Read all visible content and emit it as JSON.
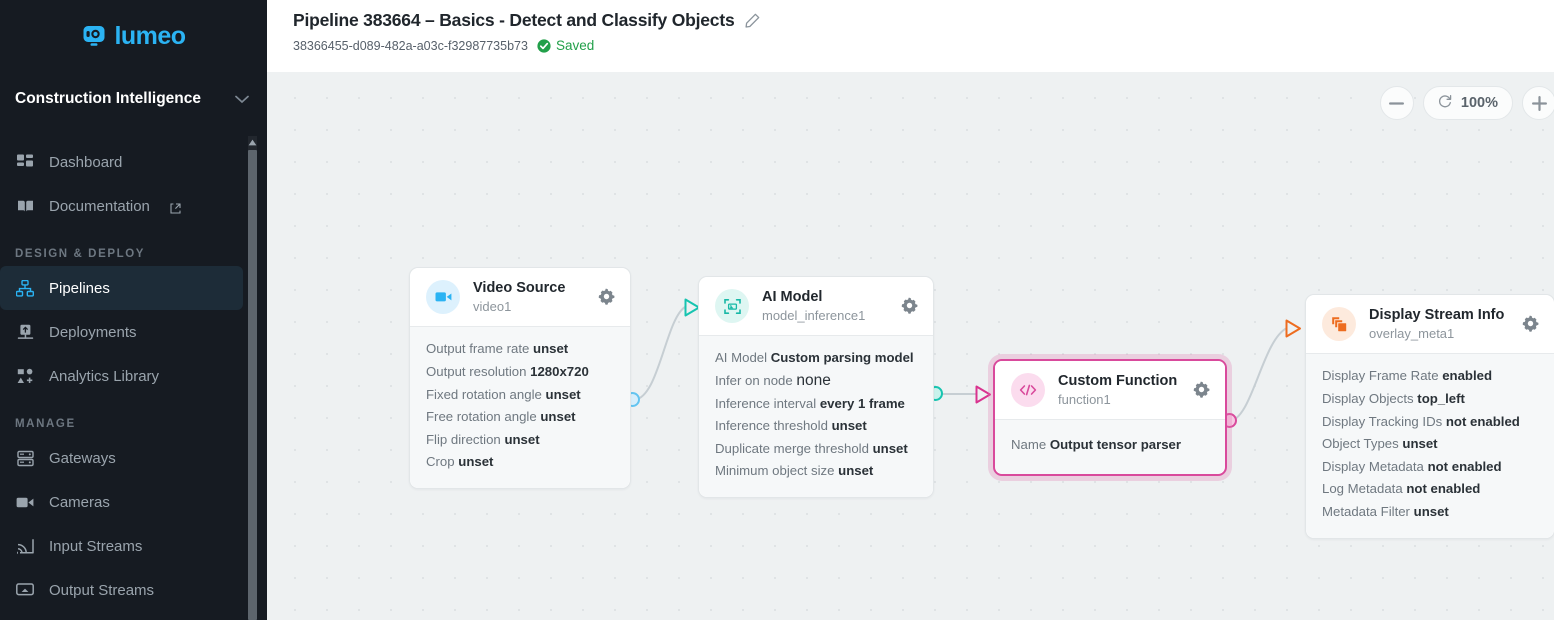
{
  "brand": {
    "name": "lumeo",
    "icon": "camera-logo-icon",
    "color": "#2bb3f3"
  },
  "sidebar": {
    "org": {
      "name": "Construction Intelligence",
      "chevron": "chevron-down-icon"
    },
    "items": [
      {
        "label": "Dashboard",
        "icon": "dashboard-grid-icon",
        "active": false,
        "external": false
      },
      {
        "label": "Documentation",
        "icon": "book-icon",
        "active": false,
        "external": true
      }
    ],
    "sections": [
      {
        "label": "DESIGN & DEPLOY",
        "items": [
          {
            "label": "Pipelines",
            "icon": "pipeline-nodes-icon",
            "active": true,
            "external": false
          },
          {
            "label": "Deployments",
            "icon": "deployment-upload-icon",
            "active": false,
            "external": false
          },
          {
            "label": "Analytics Library",
            "icon": "analytics-shapes-icon",
            "active": false,
            "external": false
          }
        ]
      },
      {
        "label": "MANAGE",
        "items": [
          {
            "label": "Gateways",
            "icon": "server-rack-icon",
            "active": false,
            "external": false
          },
          {
            "label": "Cameras",
            "icon": "video-camera-icon",
            "active": false,
            "external": false
          },
          {
            "label": "Input Streams",
            "icon": "stream-cast-icon",
            "active": false,
            "external": false
          },
          {
            "label": "Output Streams",
            "icon": "monitor-output-icon",
            "active": false,
            "external": false
          }
        ]
      }
    ]
  },
  "header": {
    "title": "Pipeline 383664 – Basics - Detect and Classify Objects",
    "edit_icon": "pencil-icon",
    "pipeline_id": "38366455-d089-482a-a03c-f32987735b73",
    "status_icon": "check-circle-icon",
    "status_text": "Saved",
    "status_color": "#22a04a"
  },
  "canvas": {
    "zoom": {
      "minus_label": "−",
      "plus_label": "+",
      "reset_icon": "refresh-icon",
      "level": "100%"
    },
    "nodes": [
      {
        "id": "video-source",
        "title": "Video Source",
        "subtitle": "video1",
        "icon": "video-camera-icon",
        "icon_color": "#2bb3f3",
        "avatar_bg": "#ddf1fd",
        "gear_icon": "gear-icon",
        "selected": false,
        "props": [
          {
            "label": "Output frame rate",
            "value": "unset",
            "emphasis": "normal"
          },
          {
            "label": "Output resolution",
            "value": "1280x720",
            "emphasis": "normal"
          },
          {
            "label": "Fixed rotation angle",
            "value": "unset",
            "emphasis": "normal"
          },
          {
            "label": "Free rotation angle",
            "value": "unset",
            "emphasis": "normal"
          },
          {
            "label": "Flip direction",
            "value": "unset",
            "emphasis": "normal"
          },
          {
            "label": "Crop",
            "value": "unset",
            "emphasis": "normal"
          }
        ]
      },
      {
        "id": "ai-model",
        "title": "AI Model",
        "subtitle": "model_inference1",
        "icon": "image-scan-icon",
        "icon_color": "#17b8a6",
        "avatar_bg": "#def6f2",
        "gear_icon": "gear-icon",
        "selected": false,
        "props": [
          {
            "label": "AI Model",
            "value": "Custom parsing model",
            "emphasis": "normal"
          },
          {
            "label": "Infer on node",
            "value": "none",
            "emphasis": "large"
          },
          {
            "label": "Inference interval",
            "value": "every 1 frame",
            "emphasis": "normal"
          },
          {
            "label": "Inference threshold",
            "value": "unset",
            "emphasis": "normal"
          },
          {
            "label": "Duplicate merge threshold",
            "value": "unset",
            "emphasis": "normal"
          },
          {
            "label": "Minimum object size",
            "value": "unset",
            "emphasis": "normal"
          }
        ]
      },
      {
        "id": "custom-function",
        "title": "Custom Function",
        "subtitle": "function1",
        "icon": "code-brackets-icon",
        "icon_color": "#d94a9c",
        "avatar_bg": "#fbdcee",
        "gear_icon": "gear-icon",
        "selected": true,
        "props": [
          {
            "label": "Name",
            "value": "Output tensor parser",
            "emphasis": "normal"
          }
        ]
      },
      {
        "id": "display-stream-info",
        "title": "Display Stream Info",
        "subtitle": "overlay_meta1",
        "icon": "layers-copy-icon",
        "icon_color": "#ed6c1f",
        "avatar_bg": "#fdeadd",
        "gear_icon": "gear-icon",
        "selected": false,
        "props": [
          {
            "label": "Display Frame Rate",
            "value": "enabled",
            "emphasis": "normal"
          },
          {
            "label": "Display Objects",
            "value": "top_left",
            "emphasis": "normal"
          },
          {
            "label": "Display Tracking IDs",
            "value": "not enabled",
            "emphasis": "normal"
          },
          {
            "label": "Object Types",
            "value": "unset",
            "emphasis": "normal"
          },
          {
            "label": "Display Metadata",
            "value": "not enabled",
            "emphasis": "normal"
          },
          {
            "label": "Log Metadata",
            "value": "not enabled",
            "emphasis": "normal"
          },
          {
            "label": "Metadata Filter",
            "value": "unset",
            "emphasis": "normal"
          }
        ]
      }
    ],
    "edges": [
      {
        "from": "video-source",
        "to": "ai-model",
        "source_color": "#63c4f0",
        "target_color": "#17c4b0"
      },
      {
        "from": "ai-model",
        "to": "custom-function",
        "source_color": "#17c4b0",
        "target_color": "#d94a9c"
      },
      {
        "from": "custom-function",
        "to": "display-stream-info",
        "source_color": "#e87ab8",
        "target_color": "#ed6c1f"
      }
    ]
  }
}
